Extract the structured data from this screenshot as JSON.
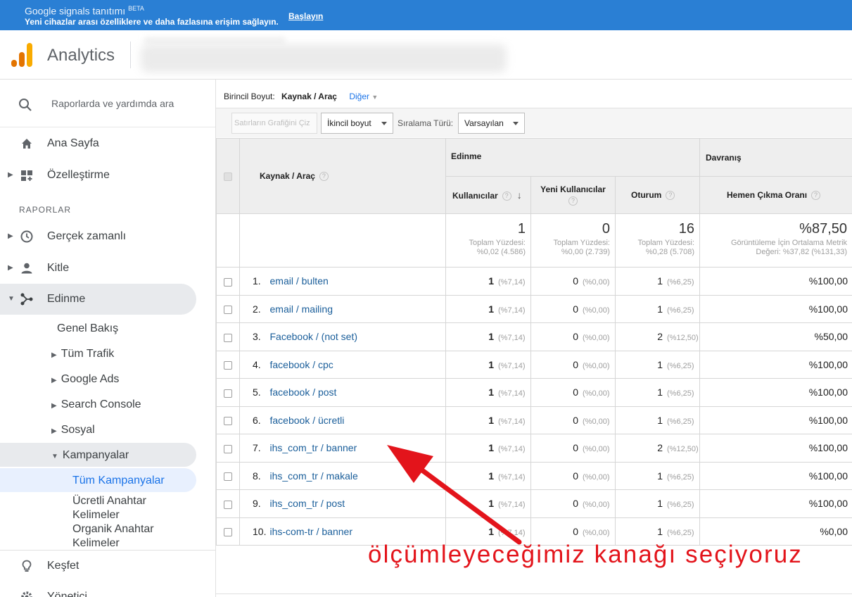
{
  "banner": {
    "title": "Google signals tanıtımı",
    "beta": "BETA",
    "subtitle": "Yeni cihazlar arası özelliklere ve daha fazlasına erişim sağlayın.",
    "link": "Başlayın",
    "color": "#2a7fd4"
  },
  "app": {
    "name": "Analytics",
    "logo_colors": [
      "#f9ab00",
      "#e37400"
    ]
  },
  "sidebar": {
    "search_placeholder": "Raporlarda ve yardımda ara",
    "home": "Ana Sayfa",
    "customization": "Özelleştirme",
    "reports_section": "RAPORLAR",
    "realtime": "Gerçek zamanlı",
    "audience": "Kitle",
    "acquisition": "Edinme",
    "acq_items": {
      "overview": "Genel Bakış",
      "all_traffic": "Tüm Trafik",
      "google_ads": "Google Ads",
      "search_console": "Search Console",
      "social": "Sosyal",
      "campaigns": "Kampanyalar",
      "all_campaigns": "Tüm Kampanyalar",
      "paid_keywords_1": "Ücretli Anahtar",
      "paid_keywords_2": "Kelimeler",
      "organic_keywords_1": "Organik Anahtar",
      "organic_keywords_2": "Kelimeler"
    },
    "discover": "Keşfet",
    "admin": "Yönetici"
  },
  "report": {
    "primary_dimension_label": "Birincil Boyut:",
    "primary_dimension_value": "Kaynak / Araç",
    "other": "Diğer",
    "plot_rows": "Satırların Grafiğini Çiz",
    "secondary_dimension": "İkincil boyut",
    "sort_type_label": "Sıralama Türü:",
    "sort_type_value": "Varsayılan"
  },
  "table": {
    "groups": {
      "acquisition": "Edinme",
      "behavior": "Davranış"
    },
    "headers": {
      "dimension": "Kaynak / Araç",
      "users": "Kullanıcılar",
      "new_users": "Yeni Kullanıcılar",
      "sessions": "Oturum",
      "bounce": "Hemen Çıkma Oranı"
    },
    "totals": {
      "users": "1",
      "users_sub1": "Toplam Yüzdesi:",
      "users_sub2": "%0,02 (4.586)",
      "new_users": "0",
      "new_users_sub1": "Toplam Yüzdesi:",
      "new_users_sub2": "%0,00 (2.739)",
      "sessions": "16",
      "sessions_sub1": "Toplam Yüzdesi:",
      "sessions_sub2": "%0,28 (5.708)",
      "bounce": "%87,50",
      "bounce_sub1": "Görüntüleme İçin Ortalama Metrik",
      "bounce_sub2": "Değeri: %37,82 (%131,33)"
    },
    "rows": [
      {
        "idx": "1.",
        "name": "email / bulten",
        "users": "1",
        "users_pct": "(%7,14)",
        "new": "0",
        "new_pct": "(%0,00)",
        "sess": "1",
        "sess_pct": "(%6,25)",
        "bounce": "%100,00"
      },
      {
        "idx": "2.",
        "name": "email / mailing",
        "users": "1",
        "users_pct": "(%7,14)",
        "new": "0",
        "new_pct": "(%0,00)",
        "sess": "1",
        "sess_pct": "(%6,25)",
        "bounce": "%100,00"
      },
      {
        "idx": "3.",
        "name": "Facebook / (not set)",
        "users": "1",
        "users_pct": "(%7,14)",
        "new": "0",
        "new_pct": "(%0,00)",
        "sess": "2",
        "sess_pct": "(%12,50)",
        "bounce": "%50,00"
      },
      {
        "idx": "4.",
        "name": "facebook / cpc",
        "users": "1",
        "users_pct": "(%7,14)",
        "new": "0",
        "new_pct": "(%0,00)",
        "sess": "1",
        "sess_pct": "(%6,25)",
        "bounce": "%100,00"
      },
      {
        "idx": "5.",
        "name": "facebook / post",
        "users": "1",
        "users_pct": "(%7,14)",
        "new": "0",
        "new_pct": "(%0,00)",
        "sess": "1",
        "sess_pct": "(%6,25)",
        "bounce": "%100,00"
      },
      {
        "idx": "6.",
        "name": "facebook / ücretli",
        "users": "1",
        "users_pct": "(%7,14)",
        "new": "0",
        "new_pct": "(%0,00)",
        "sess": "1",
        "sess_pct": "(%6,25)",
        "bounce": "%100,00"
      },
      {
        "idx": "7.",
        "name": "ihs_com_tr / banner",
        "users": "1",
        "users_pct": "(%7,14)",
        "new": "0",
        "new_pct": "(%0,00)",
        "sess": "2",
        "sess_pct": "(%12,50)",
        "bounce": "%100,00"
      },
      {
        "idx": "8.",
        "name": "ihs_com_tr / makale",
        "users": "1",
        "users_pct": "(%7,14)",
        "new": "0",
        "new_pct": "(%0,00)",
        "sess": "1",
        "sess_pct": "(%6,25)",
        "bounce": "%100,00"
      },
      {
        "idx": "9.",
        "name": "ihs_com_tr / post",
        "users": "1",
        "users_pct": "(%7,14)",
        "new": "0",
        "new_pct": "(%0,00)",
        "sess": "1",
        "sess_pct": "(%6,25)",
        "bounce": "%100,00"
      },
      {
        "idx": "10.",
        "name": "ihs-com-tr / banner",
        "users": "1",
        "users_pct": "(%7,14)",
        "new": "0",
        "new_pct": "(%0,00)",
        "sess": "1",
        "sess_pct": "(%6,25)",
        "bounce": "%0,00"
      }
    ]
  },
  "annotation": {
    "text": "ölçümleyeceğimiz kanağı seçiyoruz",
    "color": "#e3141b"
  }
}
